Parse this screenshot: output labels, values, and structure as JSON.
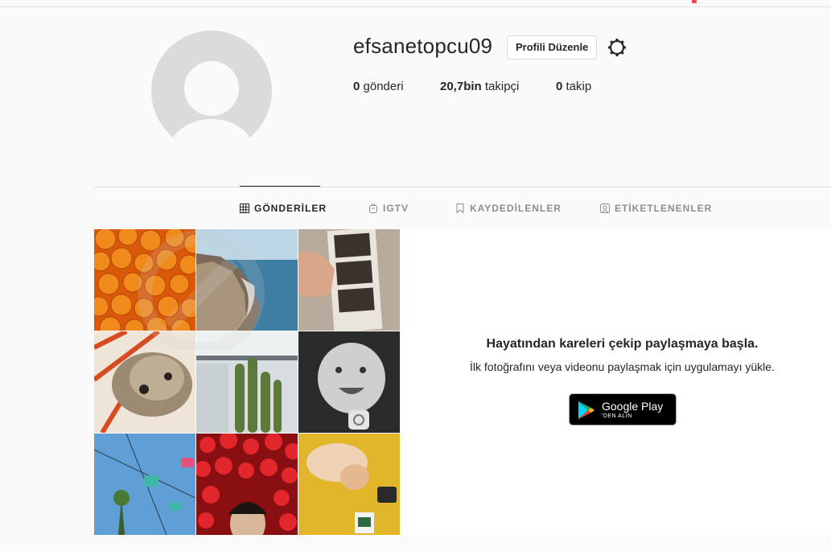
{
  "profile": {
    "username": "efsanetopcu09",
    "edit_label": "Profili Düzenle"
  },
  "stats": [
    {
      "value": "0",
      "label": "gönderi"
    },
    {
      "value": "20,7bin",
      "label": "takipçi"
    },
    {
      "value": "0",
      "label": "takip"
    }
  ],
  "tabs": [
    {
      "label": "GÖNDERİLER",
      "icon": "grid-icon",
      "active": true
    },
    {
      "label": "IGTV",
      "icon": "tv-icon",
      "active": false
    },
    {
      "label": "KAYDEDİLENLER",
      "icon": "bookmark-icon",
      "active": false
    },
    {
      "label": "ETİKETLENENLER",
      "icon": "tag-person-icon",
      "active": false
    }
  ],
  "promo": {
    "title": "Hayatından kareleri çekip paylaşmaya başla.",
    "subtitle": "İlk fotoğrafını veya videonu paylaşmak için uygulamayı yükle.",
    "store_line1": "Google Play",
    "store_line2": "'DEN ALIN"
  },
  "colors": {
    "accent": "#262626",
    "muted": "#8e8e8e",
    "border": "#dbdbdb",
    "background": "#fafafa"
  }
}
